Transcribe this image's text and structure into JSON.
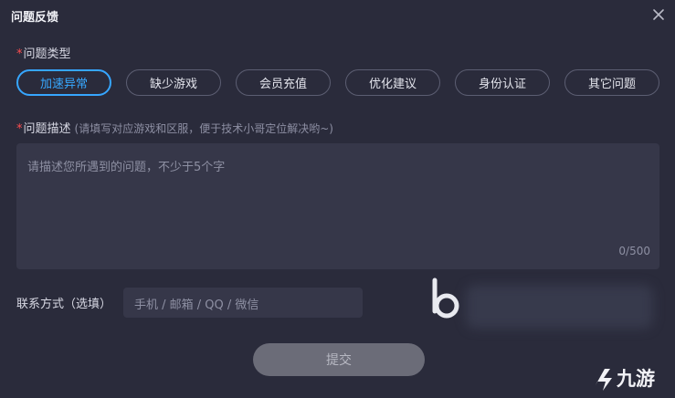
{
  "dialog": {
    "title": "问题反馈",
    "close_icon": "close-icon"
  },
  "category": {
    "required_mark": "*",
    "label": "问题类型",
    "options": [
      "加速异常",
      "缺少游戏",
      "会员充值",
      "优化建议",
      "身份认证",
      "其它问题"
    ],
    "selected": "加速异常"
  },
  "description": {
    "required_mark": "*",
    "label": "问题描述",
    "hint": "(请填写对应游戏和区服，便于技术小哥定位解决哟~)",
    "placeholder": "请描述您所遇到的问题，不少于5个字",
    "counter": "0/500"
  },
  "contact": {
    "label": "联系方式（选填）",
    "placeholder": "手机 / 邮箱 / QQ / 微信"
  },
  "submit_label": "提交",
  "watermark": {
    "site_text": "九游"
  },
  "colors": {
    "background": "#2a2b3b",
    "accent": "#36a6ff",
    "required": "#ff4d4f",
    "field": "#363749"
  }
}
